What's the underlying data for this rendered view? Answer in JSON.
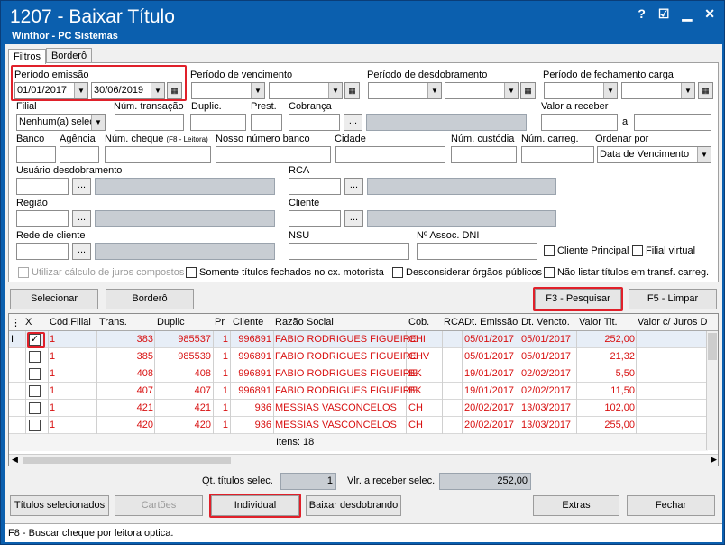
{
  "window": {
    "title": "1207 - Baixar Título",
    "subtitle": "Winthor - PC Sistemas",
    "help": "?",
    "min": "▁",
    "close": "✕"
  },
  "tabs": [
    "Filtros",
    "Borderô"
  ],
  "filters": {
    "periodo_emissao": "Período emissão",
    "emissao_de": "01/01/2017",
    "emissao_ate": "30/06/2019",
    "periodo_vencimento": "Período de vencimento",
    "periodo_desdobramento": "Período de desdobramento",
    "periodo_fechamento": "Período de fechamento carga",
    "filial": "Filial",
    "filial_value": "Nenhum(a) selec",
    "num_transacao": "Núm. transação",
    "duplic": "Duplic.",
    "prest": "Prest.",
    "cobranca": "Cobrança",
    "valor_receber": "Valor a receber",
    "a": "a",
    "banco": "Banco",
    "agencia": "Agência",
    "num_cheque": "Núm. cheque",
    "leitora": "(F8 - Leitora)",
    "nosso_numero": "Nosso número banco",
    "cidade": "Cidade",
    "num_custodia": "Núm. custódia",
    "num_carreg": "Núm. carreg.",
    "ordenar_por": "Ordenar por",
    "ordenar_value": "Data de Vencimento",
    "usuario_desdobramento": "Usuário desdobramento",
    "rca": "RCA",
    "regiao": "Região",
    "cliente": "Cliente",
    "rede_cliente": "Rede de cliente",
    "nsu": "NSU",
    "assoc_dni": "Nº Assoc. DNI",
    "cliente_principal": "Cliente Principal",
    "filial_virtual": "Filial virtual",
    "juros": "Utilizar cálculo de juros compostos",
    "somente_fechados": "Somente títulos fechados no cx. motorista",
    "desconsiderar": "Desconsiderar órgãos públicos",
    "nao_listar": "Não listar títulos em transf. carreg."
  },
  "buttons": {
    "selecionar": "Selecionar",
    "bordero": "Borderô",
    "pesquisar": "F3 - Pesquisar",
    "limpar": "F5 - Limpar",
    "titulos_sel": "Títulos selecionados",
    "cartoes": "Cartões",
    "individual": "Individual",
    "baixar_desd": "Baixar desdobrando",
    "extras": "Extras",
    "fechar": "Fechar"
  },
  "grid": {
    "headers": [
      "X",
      "Cód.Filial",
      "Trans.",
      "Duplic",
      "Pr",
      "Cliente",
      "Razão Social",
      "Cob.",
      "RCA",
      "Dt. Emissão",
      "Dt. Vencto.",
      "Valor Tit.",
      "Valor c/ Juros D"
    ],
    "rows": [
      {
        "checked": true,
        "filial": "1",
        "trans": "383",
        "duplic": "985537",
        "pr": "1",
        "cliente": "996891",
        "razao": "FABIO RODRIGUES FIGUEIRE",
        "cob": "CHI",
        "emissao": "05/01/2017",
        "vencto": "05/01/2017",
        "valor": "252,00"
      },
      {
        "checked": false,
        "filial": "1",
        "trans": "385",
        "duplic": "985539",
        "pr": "1",
        "cliente": "996891",
        "razao": "FABIO RODRIGUES FIGUEIRE",
        "cob": "CHV",
        "emissao": "05/01/2017",
        "vencto": "05/01/2017",
        "valor": "21,32"
      },
      {
        "checked": false,
        "filial": "1",
        "trans": "408",
        "duplic": "408",
        "pr": "1",
        "cliente": "996891",
        "razao": "FABIO RODRIGUES FIGUEIRE",
        "cob": "BK",
        "emissao": "19/01/2017",
        "vencto": "02/02/2017",
        "valor": "5,50"
      },
      {
        "checked": false,
        "filial": "1",
        "trans": "407",
        "duplic": "407",
        "pr": "1",
        "cliente": "996891",
        "razao": "FABIO RODRIGUES FIGUEIRE",
        "cob": "BK",
        "emissao": "19/01/2017",
        "vencto": "02/02/2017",
        "valor": "11,50"
      },
      {
        "checked": false,
        "filial": "1",
        "trans": "421",
        "duplic": "421",
        "pr": "1",
        "cliente": "936",
        "razao": "MESSIAS VASCONCELOS",
        "cob": "CH",
        "emissao": "20/02/2017",
        "vencto": "13/03/2017",
        "valor": "102,00"
      },
      {
        "checked": false,
        "filial": "1",
        "trans": "420",
        "duplic": "420",
        "pr": "1",
        "cliente": "936",
        "razao": "MESSIAS VASCONCELOS",
        "cob": "CH",
        "emissao": "20/02/2017",
        "vencto": "13/03/2017",
        "valor": "255,00"
      }
    ],
    "itens": "Itens: 18",
    "row_marker": "I"
  },
  "totals": {
    "qt_label": "Qt. títulos selec.",
    "qt_value": "1",
    "vlr_label": "Vlr. a receber selec.",
    "vlr_value": "252,00"
  },
  "status": "F8 - Buscar cheque por leitora optica."
}
